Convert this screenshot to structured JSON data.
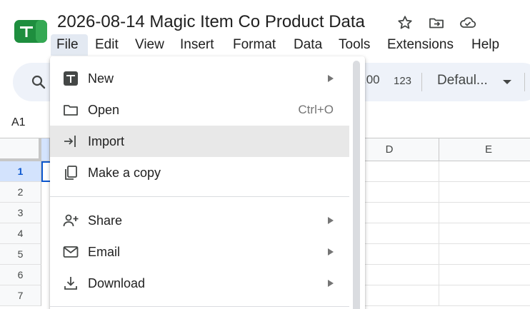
{
  "app": {
    "document_title": "2026-08-14 Magic Item Co Product Data",
    "accent_color": "#0b57d0",
    "logo_color": "#1e8e3e",
    "icons": [
      "star-icon",
      "move-to-folder-icon",
      "cloud-saved-icon"
    ]
  },
  "menubar": {
    "items": [
      "File",
      "Edit",
      "View",
      "Insert",
      "Format",
      "Data",
      "Tools",
      "Extensions",
      "Help"
    ],
    "active": "File"
  },
  "toolbar": {
    "decimal_format_label": ".00",
    "number_format_label": "123",
    "font_label": "Defaul..."
  },
  "namebox": {
    "value": "A1"
  },
  "grid": {
    "columns": [
      "D",
      "E"
    ],
    "rows": [
      "1",
      "2",
      "3",
      "4",
      "5",
      "6",
      "7"
    ],
    "selected_cell": "A1"
  },
  "file_menu": {
    "items": [
      {
        "label": "New",
        "icon": "new-sheet-icon",
        "submenu": true
      },
      {
        "label": "Open",
        "icon": "folder-icon",
        "shortcut": "Ctrl+O"
      },
      {
        "label": "Import",
        "icon": "import-icon",
        "highlighted": true
      },
      {
        "label": "Make a copy",
        "icon": "copy-icon"
      },
      {
        "label": "Share",
        "icon": "share-icon",
        "submenu": true
      },
      {
        "label": "Email",
        "icon": "email-icon",
        "submenu": true
      },
      {
        "label": "Download",
        "icon": "download-icon",
        "submenu": true
      }
    ]
  }
}
